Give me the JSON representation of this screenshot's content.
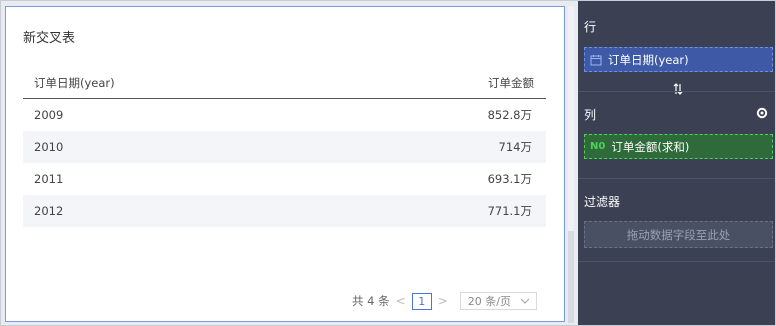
{
  "card": {
    "title": "新交叉表"
  },
  "table": {
    "headers": [
      "订单日期(year)",
      "订单金额"
    ],
    "rows": [
      [
        "2009",
        "852.8万"
      ],
      [
        "2010",
        "714万"
      ],
      [
        "2011",
        "693.1万"
      ],
      [
        "2012",
        "771.1万"
      ]
    ]
  },
  "pager": {
    "total": "共 4 条",
    "prev": "<",
    "current_page": "1",
    "next": ">",
    "page_size": "20 条/页"
  },
  "panel": {
    "rows_label": "行",
    "row_field": "订单日期(year)",
    "columns_label": "列",
    "column_field": "订单金额(求和)",
    "column_field_badge": "N0",
    "filter_label": "过滤器",
    "filter_placeholder": "拖动数据字段至此处"
  },
  "colors": {
    "accent": "#4a74d9",
    "panel_bg": "#3b4053",
    "row_chip": "#3e5aa6",
    "col_chip": "#2f6a3a",
    "measure_green": "#4fd05a"
  },
  "icons": [
    "calendar-icon",
    "swap-icon",
    "gear-icon",
    "chevron-down-icon"
  ]
}
